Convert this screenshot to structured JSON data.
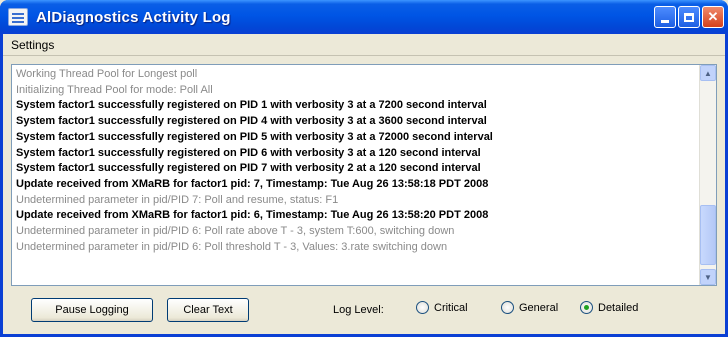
{
  "window": {
    "title": "AlDiagnostics Activity Log"
  },
  "menu": {
    "items": [
      "Settings"
    ]
  },
  "log": {
    "lines": [
      {
        "text": "Working Thread Pool for Longest poll",
        "dim": true
      },
      {
        "text": "Initializing Thread Pool for mode: Poll All",
        "dim": true
      },
      {
        "text": "System factor1 successfully registered on PID 1 with verbosity 3 at a 7200 second interval",
        "dim": false
      },
      {
        "text": "System factor1 successfully registered on PID 4 with verbosity 3 at a 3600 second interval",
        "dim": false
      },
      {
        "text": "System factor1 successfully registered on PID 5 with verbosity 3 at a 72000 second interval",
        "dim": false
      },
      {
        "text": "System factor1 successfully registered on PID 6 with verbosity 3 at a 120 second interval",
        "dim": false
      },
      {
        "text": "System factor1 successfully registered on PID 7 with verbosity 2 at a 120 second interval",
        "dim": false
      },
      {
        "text": "Update received from XMaRB for factor1 pid: 7, Timestamp: Tue Aug 26 13:58:18 PDT 2008",
        "dim": false
      },
      {
        "text": "Undetermined parameter in pid/PID 7: Poll and resume, status: F1",
        "dim": true
      },
      {
        "text": "Update received from XMaRB for factor1 pid: 6, Timestamp: Tue Aug 26 13:58:20 PDT 2008",
        "dim": false
      },
      {
        "text": "Undetermined parameter in pid/PID 6: Poll rate above T - 3, system T:600, switching down",
        "dim": true
      },
      {
        "text": "Undetermined parameter in pid/PID 6: Poll threshold T - 3, Values: 3.rate switching down",
        "dim": true
      }
    ]
  },
  "controls": {
    "pause_label": "Pause Logging",
    "clear_label": "Clear Text",
    "log_level_label": "Log Level:",
    "levels": [
      {
        "label": "Critical",
        "selected": false
      },
      {
        "label": "General",
        "selected": false
      },
      {
        "label": "Detailed",
        "selected": true
      }
    ]
  }
}
